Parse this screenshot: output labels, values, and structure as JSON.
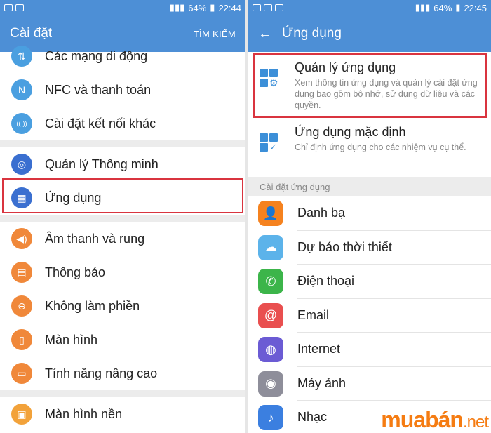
{
  "left": {
    "status": {
      "time": "22:44",
      "battery": "64%"
    },
    "appbar": {
      "title": "Cài đặt",
      "action": "TÌM KIẾM"
    },
    "items": [
      {
        "label": "Các mạng di động",
        "icon": "network-icon",
        "color": "#4a9fe0"
      },
      {
        "label": "NFC và thanh toán",
        "icon": "nfc-icon",
        "color": "#4a9fe0"
      },
      {
        "label": "Cài đặt kết nối khác",
        "icon": "connection-icon",
        "color": "#4a9fe0"
      },
      {
        "label": "Quản lý Thông minh",
        "icon": "smart-manager-icon",
        "color": "#3a6fd0"
      },
      {
        "label": "Ứng dụng",
        "icon": "apps-icon",
        "color": "#3a6fd0"
      },
      {
        "label": "Âm thanh và rung",
        "icon": "sound-icon",
        "color": "#f0883a"
      },
      {
        "label": "Thông báo",
        "icon": "notification-icon",
        "color": "#f0883a"
      },
      {
        "label": "Không làm phiền",
        "icon": "do-not-disturb-icon",
        "color": "#f0883a"
      },
      {
        "label": "Màn hình",
        "icon": "display-icon",
        "color": "#f0883a"
      },
      {
        "label": "Tính năng nâng cao",
        "icon": "advanced-features-icon",
        "color": "#f0883a"
      },
      {
        "label": "Màn hình nền",
        "icon": "wallpaper-icon",
        "color": "#f2a23a"
      }
    ]
  },
  "right": {
    "status": {
      "time": "22:45",
      "battery": "64%"
    },
    "appbar": {
      "title": "Ứng dụng"
    },
    "top_items": [
      {
        "title": "Quản lý ứng dụng",
        "desc": "Xem thông tin ứng dụng và quản lý cài đặt ứng dụng bao gồm bộ nhớ, sử dụng dữ liệu và các quyền."
      },
      {
        "title": "Ứng dụng mặc định",
        "desc": "Chỉ định ứng dụng cho các nhiệm vụ cụ thể."
      }
    ],
    "category": "Cài đặt ứng dụng",
    "apps": [
      {
        "label": "Danh bạ",
        "icon": "contacts-icon",
        "color": "#f5821f"
      },
      {
        "label": "Dự báo thời thiết",
        "icon": "weather-icon",
        "color": "#5cb3ea"
      },
      {
        "label": "Điện thoại",
        "icon": "phone-icon",
        "color": "#3cb54a"
      },
      {
        "label": "Email",
        "icon": "email-icon",
        "color": "#e94f4f"
      },
      {
        "label": "Internet",
        "icon": "internet-icon",
        "color": "#6b5bd4"
      },
      {
        "label": "Máy ảnh",
        "icon": "camera-icon",
        "color": "#8e8e9a"
      },
      {
        "label": "Nhạc",
        "icon": "music-icon",
        "color": "#3b7fe0"
      }
    ]
  },
  "watermark": {
    "brand": "muabán",
    "tld": ".net"
  }
}
